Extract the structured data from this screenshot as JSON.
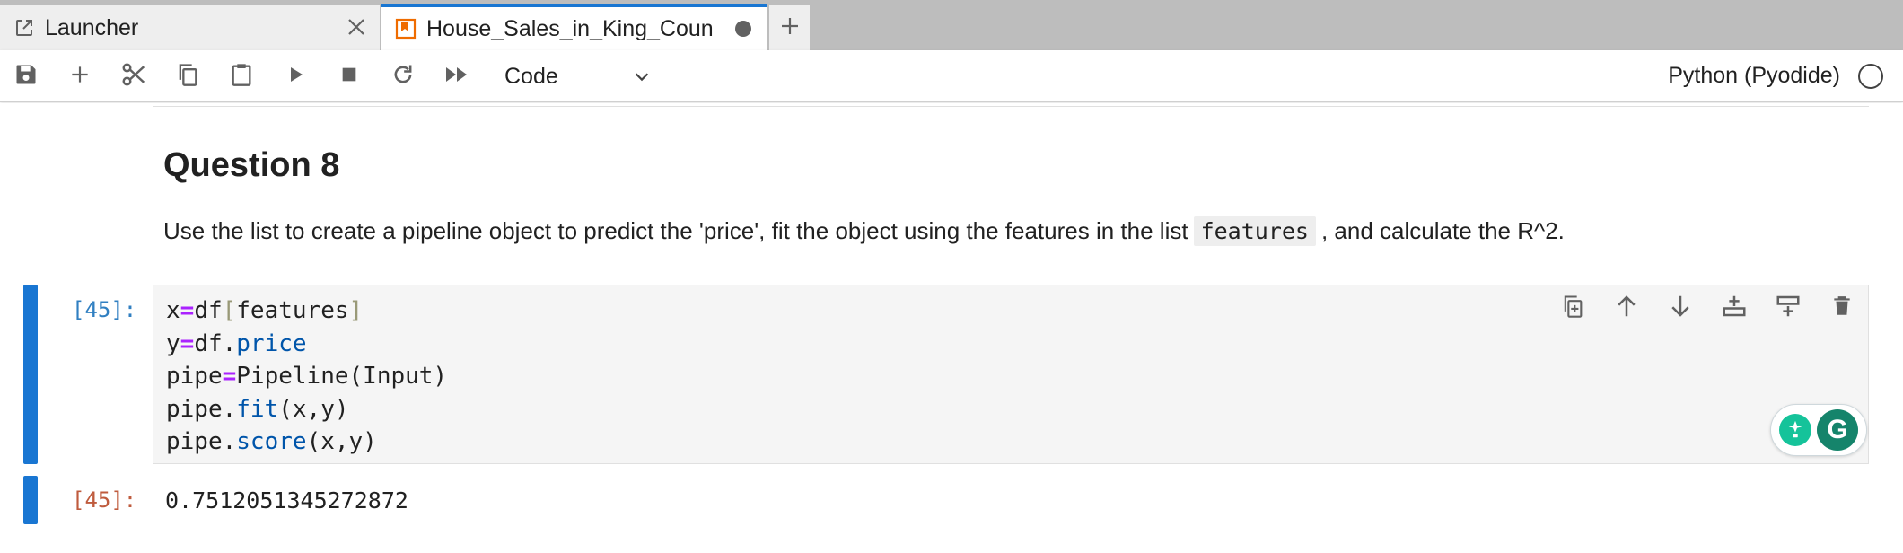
{
  "tabs": {
    "launcher": {
      "label": "Launcher",
      "icon": "external-link-icon",
      "close_icon": "close-icon"
    },
    "active": {
      "label": "House_Sales_in_King_Coun",
      "icon": "notebook-icon",
      "status": "unsaved-changes-dot"
    },
    "new_tab_icon": "plus-icon"
  },
  "toolbar": {
    "buttons": [
      "save-icon",
      "plus-icon",
      "scissors-icon",
      "copy-icon",
      "paste-icon",
      "run-icon",
      "stop-icon",
      "restart-icon",
      "fast-forward-icon"
    ],
    "cell_type": "Code",
    "kernel_name": "Python (Pyodide)",
    "kernel_status": "idle"
  },
  "markdown_cell": {
    "heading": "Question 8",
    "paragraph_before": "Use the list to create a pipeline object to predict the 'price', fit the object using the features in the list",
    "paragraph_code": "features",
    "paragraph_after": ", and calculate the R^2."
  },
  "code_cell": {
    "prompt": "[45]:",
    "lines": [
      {
        "a": "x",
        "op": "=",
        "b": "df",
        "br1": "[",
        "c": "features",
        "br2": "]"
      },
      {
        "a": "y",
        "op": "=",
        "b": "df.",
        "attr": "price"
      },
      {
        "a": "pipe",
        "op": "=",
        "b": "Pipeline(Input)"
      },
      {
        "a": "pipe.",
        "attr": "fit",
        "b": "(x,y)"
      },
      {
        "a": "pipe.",
        "attr": "score",
        "b": "(x,y)"
      }
    ],
    "actions": [
      "duplicate-icon",
      "move-up-icon",
      "move-down-icon",
      "insert-below-icon",
      "insert-above-icon",
      "delete-icon"
    ]
  },
  "output_cell": {
    "prompt": "[45]:",
    "text": "0.7512051345272872"
  },
  "grammarly": {
    "logo_letter": "G"
  },
  "colors": {
    "accent": "#1976d2",
    "prompt_in": "#307fc1",
    "prompt_out": "#bf5b3d",
    "keyword_op": "#aa22ff",
    "attribute": "#0055aa"
  }
}
